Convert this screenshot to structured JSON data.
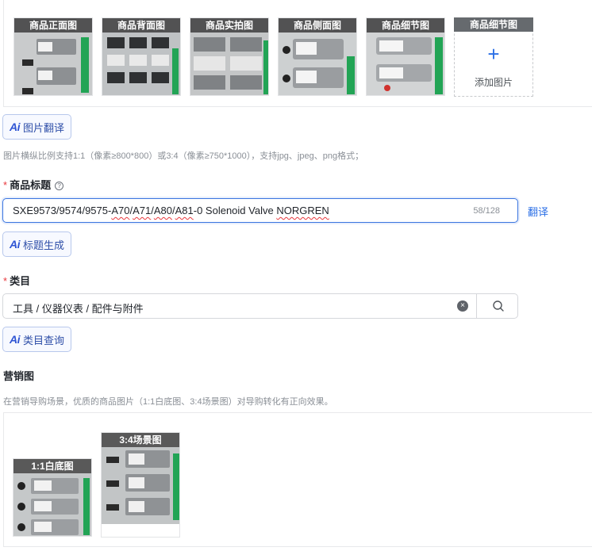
{
  "gallery": {
    "images": [
      {
        "label": "商品正面图"
      },
      {
        "label": "商品背面图"
      },
      {
        "label": "商品实拍图"
      },
      {
        "label": "商品侧面图"
      },
      {
        "label": "商品细节图"
      }
    ],
    "add_slot": {
      "label": "商品细节图",
      "plus": "+",
      "add_text": "添加图片"
    }
  },
  "ai_translate": {
    "ai": "Ai",
    "label": "图片翻译"
  },
  "image_hint": "图片横纵比例支持1:1（像素≥800*800）或3:4（像素≥750*1000），支持jpg、jpeg、png格式；",
  "title_field": {
    "required_mark": "*",
    "label": "商品标题",
    "help": "?",
    "value_parts": [
      "SXE9573/9574/9575-",
      "A70",
      "/",
      "A71",
      "/",
      "A80",
      "/",
      "A81",
      "-0 Solenoid Valve ",
      "NORGREN"
    ],
    "counter": "58/128",
    "translate_link": "翻译"
  },
  "ai_title": {
    "ai": "Ai",
    "label": "标题生成"
  },
  "category_field": {
    "required_mark": "*",
    "label": "类目",
    "value": "工具 / 仪器仪表 / 配件与附件",
    "clear": "×"
  },
  "ai_category": {
    "ai": "Ai",
    "label": "类目查询"
  },
  "marketing": {
    "label": "营销图",
    "hint": "在营销导购场景，优质的商品图片（1:1白底图、3:4场景图）对导购转化有正向效果。",
    "images": [
      {
        "label": "1:1白底图"
      },
      {
        "label": "3:4场景图"
      }
    ]
  },
  "colors": {
    "accent": "#2b6fe6",
    "required": "#e8383d",
    "ai_border": "#b8c8ec"
  }
}
